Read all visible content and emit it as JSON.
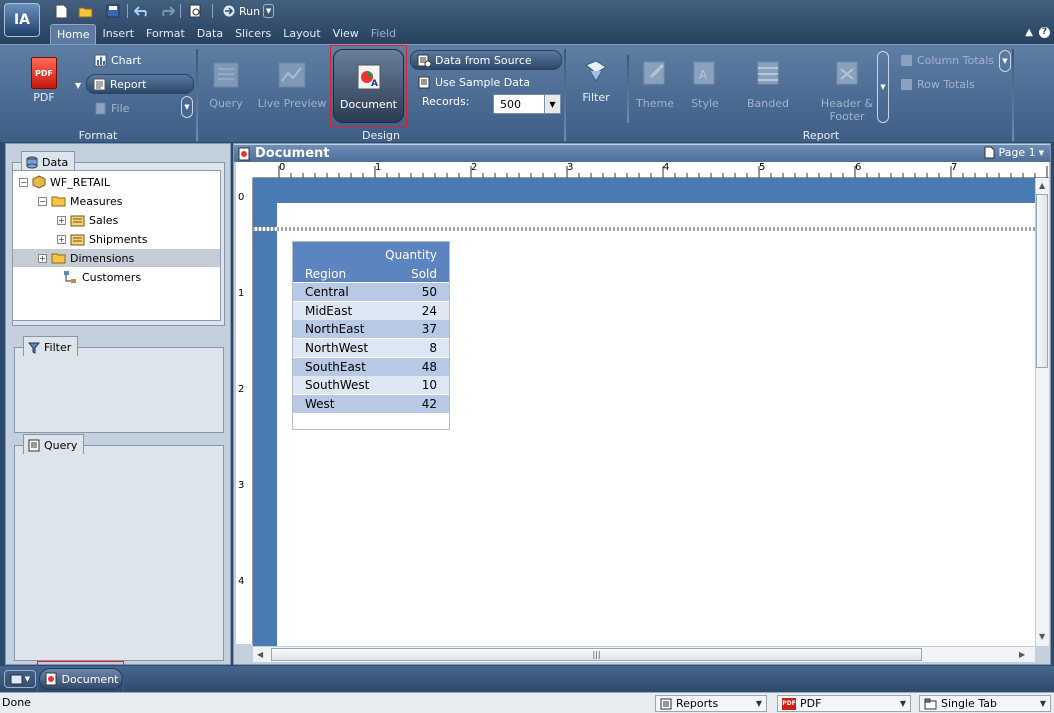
{
  "app": {
    "logo": "IA"
  },
  "quick_access": {
    "run_label": "Run",
    "icons": [
      "new-icon",
      "open-folder-icon",
      "save-icon",
      "undo-icon",
      "redo-icon",
      "print-preview-icon"
    ]
  },
  "menu": {
    "tabs": [
      {
        "label": "Home",
        "active": true
      },
      {
        "label": "Insert"
      },
      {
        "label": "Format"
      },
      {
        "label": "Data"
      },
      {
        "label": "Slicers"
      },
      {
        "label": "Layout"
      },
      {
        "label": "View"
      },
      {
        "label": "Field",
        "dim": true
      }
    ]
  },
  "ribbon": {
    "format": {
      "label": "Format",
      "pdf_label": "PDF",
      "pdf_icon_text": "PDF",
      "chart_label": "Chart",
      "report_label": "Report",
      "file_label": "File"
    },
    "design": {
      "label": "Design",
      "query_label": "Query",
      "live_preview_label": "Live Preview",
      "document_label": "Document",
      "data_from_source_label": "Data from Source",
      "use_sample_data_label": "Use Sample Data",
      "records_label": "Records:",
      "records_value": "500"
    },
    "report": {
      "label": "Report",
      "filter_label": "Filter",
      "theme_label": "Theme",
      "style_label": "Style",
      "banded_label": "Banded",
      "header_footer_label_1": "Header &",
      "header_footer_label_2": "Footer",
      "column_totals_label": "Column Totals",
      "row_totals_label": "Row Totals"
    }
  },
  "left_panel": {
    "data_title": "Data",
    "tree": [
      {
        "label": "WF_RETAIL",
        "indent": 0,
        "expander": "−"
      },
      {
        "label": "Measures",
        "indent": 1,
        "expander": "−"
      },
      {
        "label": "Sales",
        "indent": 2,
        "expander": "+"
      },
      {
        "label": "Shipments",
        "indent": 2,
        "expander": "+"
      },
      {
        "label": "Dimensions",
        "indent": 1,
        "expander": "+",
        "selected": true
      },
      {
        "label": "Customers",
        "indent": 2,
        "expander": ""
      }
    ],
    "filter_title": "Filter",
    "query_title": "Query"
  },
  "document": {
    "title": "Document",
    "page_label": "Page 1",
    "ruler_h": [
      "0",
      "1",
      "2",
      "3",
      "4",
      "5",
      "6",
      "7"
    ],
    "ruler_v": [
      "0",
      "1",
      "2",
      "3",
      "4"
    ]
  },
  "report_table": {
    "header_col1": "Region",
    "header_col2_line1": "Quantity",
    "header_col2_line2": "Sold",
    "rows": [
      {
        "region": "Central",
        "qty": "50"
      },
      {
        "region": "MidEast",
        "qty": "24"
      },
      {
        "region": "NorthEast",
        "qty": "37"
      },
      {
        "region": "NorthWest",
        "qty": "8"
      },
      {
        "region": "SouthEast",
        "qty": "48"
      },
      {
        "region": "SouthWest",
        "qty": "10"
      },
      {
        "region": "West",
        "qty": "42"
      }
    ]
  },
  "taskbar": {
    "document_label": "Document"
  },
  "status": {
    "text": "Done",
    "output_mode": "Reports",
    "format": "PDF",
    "format_icon_text": "PDF",
    "layout": "Single Tab"
  },
  "colors": {
    "accent_red": "#e0202a",
    "report_header_blue": "#5b84c0",
    "canvas_blue": "#4a7ab4"
  }
}
